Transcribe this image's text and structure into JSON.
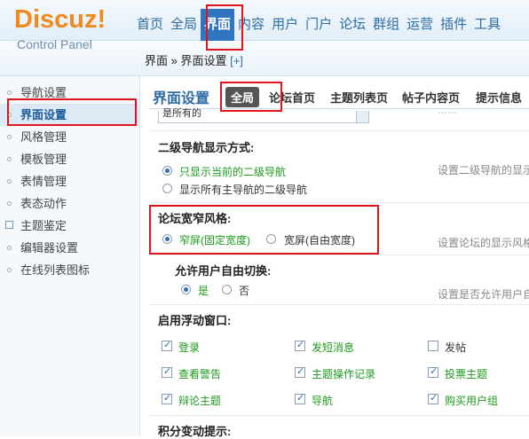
{
  "header": {
    "logo_main": "Discuz!",
    "logo_sub": "Control Panel",
    "nav": [
      "首页",
      "全局",
      "界面",
      "内容",
      "用户",
      "门户",
      "论坛",
      "群组",
      "运营",
      "插件",
      "工具"
    ]
  },
  "breadcrumb": {
    "text": "界面 » 界面设置",
    "add": "[+]"
  },
  "sidebar": {
    "items": [
      "导航设置",
      "界面设置",
      "风格管理",
      "模板管理",
      "表情管理",
      "表态动作",
      "主题鉴定",
      "编辑器设置",
      "在线列表图标"
    ]
  },
  "main": {
    "title": "界面设置",
    "tabs": [
      "全局",
      "论坛首页",
      "主题列表页",
      "帖子内容页",
      "提示信息"
    ],
    "first_select_partial": "是所有的",
    "first_hint_partial": "……",
    "nav2": {
      "label": "二级导航显示方式:",
      "options": [
        "只显示当前的二级导航",
        "显示所有主导航的二级导航"
      ],
      "hint": "设置二级导航的显示"
    },
    "width": {
      "label": "论坛宽窄风格:",
      "options": [
        "窄屏(固定宽度)",
        "宽屏(自由宽度)"
      ],
      "hint": "设置论坛的显示风格"
    },
    "switch": {
      "label": "允许用户自由切换:",
      "options": [
        "是",
        "否"
      ],
      "hint": "设置是否允许用户自由"
    },
    "float": {
      "label": "启用浮动窗口:",
      "items": [
        {
          "label": "登录",
          "checked": true
        },
        {
          "label": "发短消息",
          "checked": true
        },
        {
          "label": "发帖",
          "checked": false
        },
        {
          "label": "查看警告",
          "checked": true
        },
        {
          "label": "主题操作记录",
          "checked": true
        },
        {
          "label": "投票主题",
          "checked": true
        },
        {
          "label": "辩论主题",
          "checked": true
        },
        {
          "label": "导航",
          "checked": true
        },
        {
          "label": "购买用户组",
          "checked": true
        }
      ]
    },
    "credit": {
      "label": "积分变动提示:"
    }
  },
  "colors": {
    "accent": "#2f75c0",
    "highlight": "#e0141e",
    "option_green": "#1d9a1d"
  }
}
